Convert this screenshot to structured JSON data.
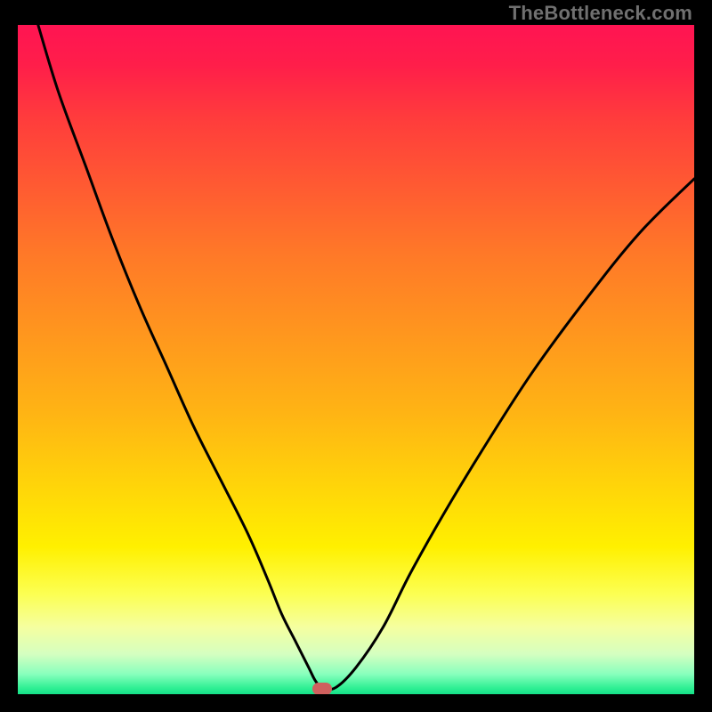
{
  "attribution": "TheBottleneck.com",
  "chart_data": {
    "type": "line",
    "title": "",
    "xlabel": "",
    "ylabel": "",
    "xlim": [
      0,
      100
    ],
    "ylim": [
      0,
      100
    ],
    "grid": false,
    "series": [
      {
        "name": "bottleneck-curve",
        "x": [
          3,
          6,
          10,
          14,
          18,
          22,
          26,
          30,
          34,
          37,
          39,
          41,
          43,
          44,
          45,
          47,
          50,
          54,
          58,
          63,
          69,
          76,
          84,
          92,
          100
        ],
        "y": [
          100,
          90,
          79,
          68,
          58,
          49,
          40,
          32,
          24,
          17,
          12,
          8,
          4,
          2,
          1,
          1,
          4,
          10,
          18,
          27,
          37,
          48,
          59,
          69,
          77
        ]
      }
    ],
    "marker": {
      "x": 45,
      "y": 0.8,
      "color": "#d0605e"
    },
    "gradient": {
      "direction": "vertical",
      "stops": [
        {
          "pos": 0.0,
          "color": "#ff1452"
        },
        {
          "pos": 0.5,
          "color": "#ffa81e"
        },
        {
          "pos": 0.8,
          "color": "#fff000"
        },
        {
          "pos": 1.0,
          "color": "#14e088"
        }
      ]
    }
  }
}
